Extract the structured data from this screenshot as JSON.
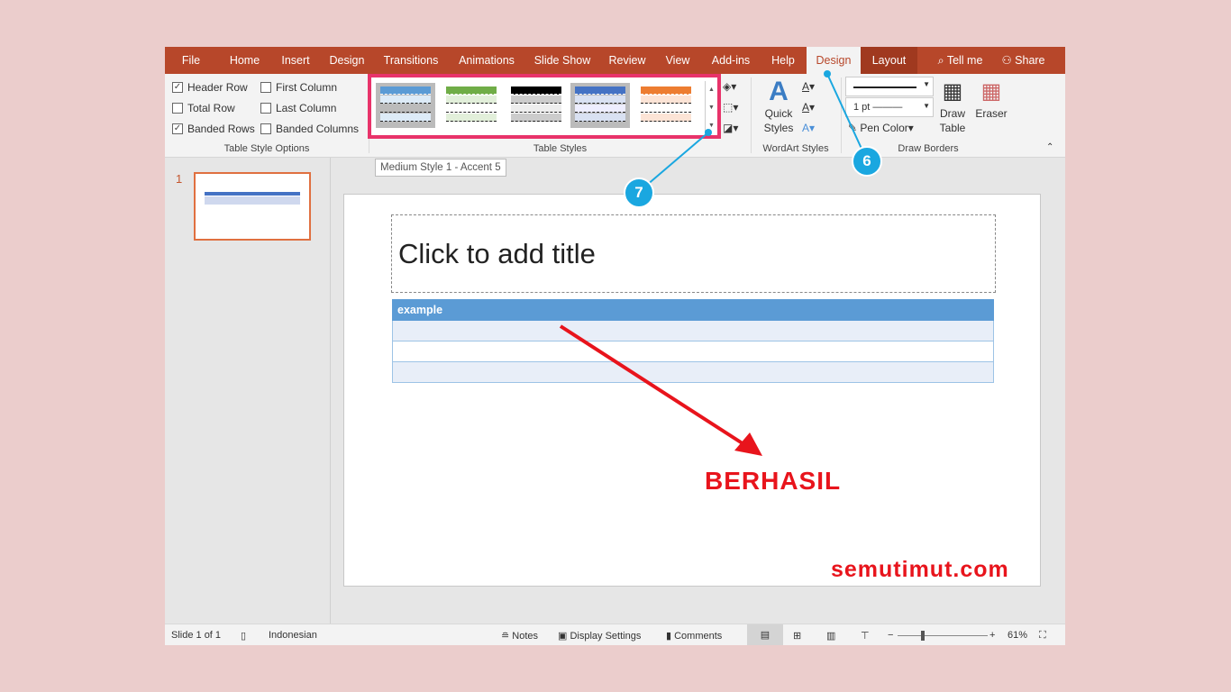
{
  "tabs": [
    "File",
    "Home",
    "Insert",
    "Design",
    "Transitions",
    "Animations",
    "Slide Show",
    "Review",
    "View",
    "Add-ins",
    "Help",
    "Design",
    "Layout"
  ],
  "tell_me": "Tell me",
  "share": "Share",
  "table_style_options": {
    "label": "Table Style Options",
    "items": [
      {
        "label": "Header Row",
        "checked": true
      },
      {
        "label": "Total Row",
        "checked": false
      },
      {
        "label": "Banded Rows",
        "checked": true
      },
      {
        "label": "First Column",
        "checked": false
      },
      {
        "label": "Last Column",
        "checked": false
      },
      {
        "label": "Banded Columns",
        "checked": false
      }
    ]
  },
  "table_styles": {
    "label": "Table Styles",
    "colors": [
      "#5b9bd5",
      "#70ad47",
      "#000000",
      "#4472c4",
      "#ed7d31"
    ]
  },
  "wordart": {
    "label": "WordArt Styles",
    "quick_styles": "Quick Styles"
  },
  "draw_borders": {
    "label": "Draw Borders",
    "weight": "1 pt",
    "pen_color": "Pen Color",
    "draw_table": "Draw Table",
    "eraser": "Eraser"
  },
  "tooltip": "Medium Style 1 - Accent 5",
  "callouts": [
    "7",
    "6"
  ],
  "slide_number": "1",
  "slide": {
    "title_placeholder": "Click to add title",
    "table_header": "example"
  },
  "annotation": "BERHASIL",
  "watermark": "semutimut.com",
  "status": {
    "slide": "Slide 1 of 1",
    "language": "Indonesian",
    "notes": "Notes",
    "display": "Display Settings",
    "comments": "Comments",
    "zoom": "61%"
  }
}
